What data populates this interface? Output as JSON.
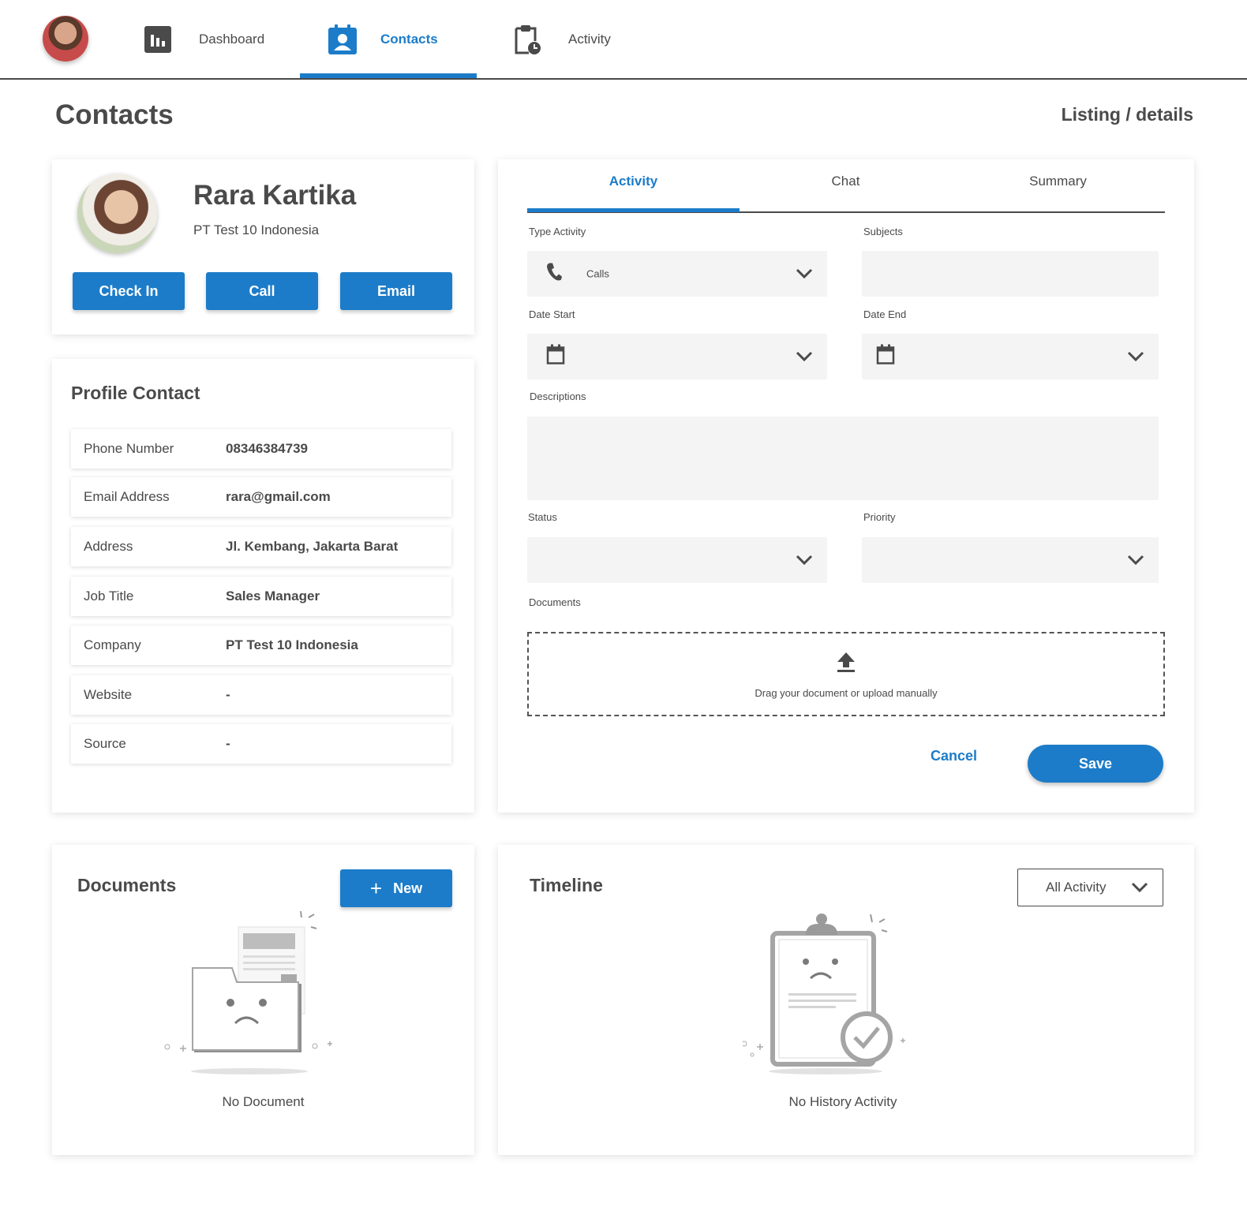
{
  "nav": {
    "items": [
      {
        "label": "Dashboard",
        "icon": "bar-chart-icon"
      },
      {
        "label": "Contacts",
        "icon": "contact-card-icon",
        "active": true
      },
      {
        "label": "Activity",
        "icon": "clipboard-clock-icon"
      }
    ]
  },
  "page": {
    "title": "Contacts",
    "breadcrumb": "Listing / details"
  },
  "contact": {
    "name": "Rara Kartika",
    "company": "PT Test 10 Indonesia",
    "actions": {
      "check_in": "Check In",
      "call": "Call",
      "email": "Email"
    }
  },
  "profile": {
    "heading": "Profile Contact",
    "rows": [
      {
        "label": "Phone Number",
        "value": "08346384739"
      },
      {
        "label": "Email Address",
        "value": "rara@gmail.com"
      },
      {
        "label": "Address",
        "value": "Jl. Kembang, Jakarta Barat"
      },
      {
        "label": "Job Title",
        "value": "Sales Manager"
      },
      {
        "label": "Company",
        "value": "PT Test 10 Indonesia"
      },
      {
        "label": "Website",
        "value": "-"
      },
      {
        "label": "Source",
        "value": "-"
      }
    ]
  },
  "form": {
    "tabs": [
      "Activity",
      "Chat",
      "Summary"
    ],
    "active_tab": "Activity",
    "type_activity": {
      "label": "Type Activity",
      "value": "Calls",
      "icon": "phone-icon"
    },
    "subjects": {
      "label": "Subjects",
      "value": ""
    },
    "date_start": {
      "label": "Date Start",
      "icon": "calendar-icon"
    },
    "date_end": {
      "label": "Date End",
      "icon": "calendar-icon"
    },
    "descriptions": {
      "label": "Descriptions"
    },
    "status": {
      "label": "Status"
    },
    "priority": {
      "label": "Priority"
    },
    "documents": {
      "label": "Documents",
      "dropzone_text": "Drag your document or upload manually",
      "icon": "upload-icon"
    },
    "cancel_label": "Cancel",
    "save_label": "Save"
  },
  "documents": {
    "heading": "Documents",
    "new_label": "New",
    "empty_text": "No Document"
  },
  "timeline": {
    "heading": "Timeline",
    "filter_value": "All Activity",
    "empty_text": "No History Activity"
  },
  "colors": {
    "accent": "#1c7cc9",
    "text": "#4a4a4a",
    "field_bg": "#f4f4f4"
  }
}
